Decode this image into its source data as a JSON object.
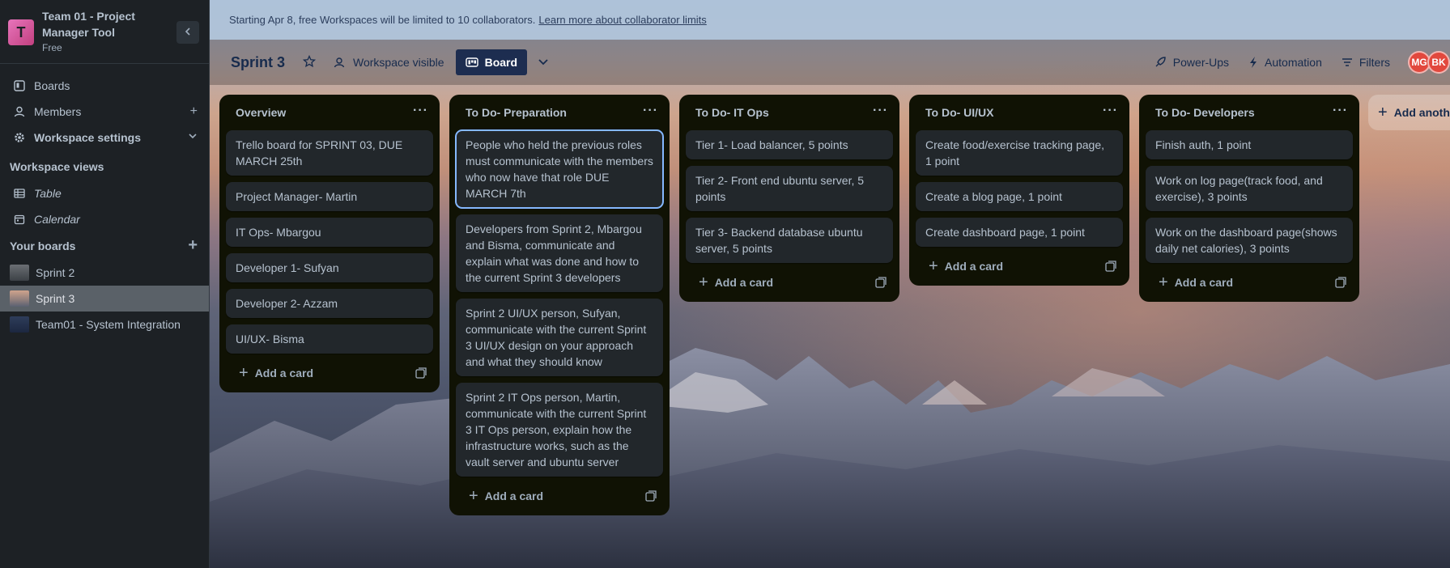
{
  "workspace": {
    "logo_letter": "T",
    "name": "Team 01 - Project Manager Tool",
    "plan": "Free"
  },
  "sidebar": {
    "nav": [
      {
        "label": "Boards"
      },
      {
        "label": "Members"
      },
      {
        "label": "Workspace settings"
      }
    ],
    "views_title": "Workspace views",
    "views": [
      {
        "label": "Table"
      },
      {
        "label": "Calendar"
      }
    ],
    "boards_title": "Your boards",
    "boards": [
      {
        "label": "Sprint 2"
      },
      {
        "label": "Sprint 3"
      },
      {
        "label": "Team01 - System Integration"
      }
    ]
  },
  "banner": {
    "text": "Starting Apr 8, free Workspaces will be limited to 10 collaborators.",
    "link": "Learn more about collaborator limits"
  },
  "board_header": {
    "title": "Sprint 3",
    "visibility": "Workspace visible",
    "view": "Board",
    "power_ups": "Power-Ups",
    "automation": "Automation",
    "filters": "Filters",
    "avatars": [
      {
        "initials": "MG",
        "color": "#e2483d"
      },
      {
        "initials": "BK",
        "color": "#e2483d"
      }
    ]
  },
  "lists": [
    {
      "title": "Overview",
      "cards": [
        "Trello board for SPRINT 03, DUE MARCH 25th",
        "Project Manager- Martin",
        "IT Ops- Mbargou",
        "Developer 1- Sufyan",
        "Developer 2- Azzam",
        "UI/UX- Bisma"
      ],
      "add_label": "Add a card"
    },
    {
      "title": "To Do- Preparation",
      "cards": [
        "People who held the previous roles must communicate with the members who now have that role DUE MARCH 7th",
        "Developers from Sprint 2, Mbargou and Bisma, communicate and explain what was done and how to the current Sprint 3 developers",
        "Sprint 2 UI/UX person, Sufyan, communicate with the current Sprint 3 UI/UX design on your approach and what they should know",
        "Sprint 2 IT Ops person, Martin, communicate with the current Sprint 3 IT Ops person, explain how the infrastructure works, such as the vault server and ubuntu server"
      ],
      "add_label": "Add a card"
    },
    {
      "title": "To Do- IT Ops",
      "cards": [
        "Tier 1- Load balancer, 5 points",
        "Tier 2- Front end ubuntu server, 5 points",
        "Tier 3- Backend database ubuntu server, 5 points"
      ],
      "add_label": "Add a card"
    },
    {
      "title": "To Do- UI/UX",
      "cards": [
        "Create food/exercise tracking page, 1 point",
        "Create a blog page, 1 point",
        "Create dashboard page, 1 point"
      ],
      "add_label": "Add a card"
    },
    {
      "title": "To Do- Developers",
      "cards": [
        "Finish auth, 1 point",
        "Work on log page(track food, and exercise), 3 points",
        "Work on the dashboard page(shows daily net calories), 3 points"
      ],
      "add_label": "Add a card"
    }
  ],
  "add_list_label": "Add another list"
}
